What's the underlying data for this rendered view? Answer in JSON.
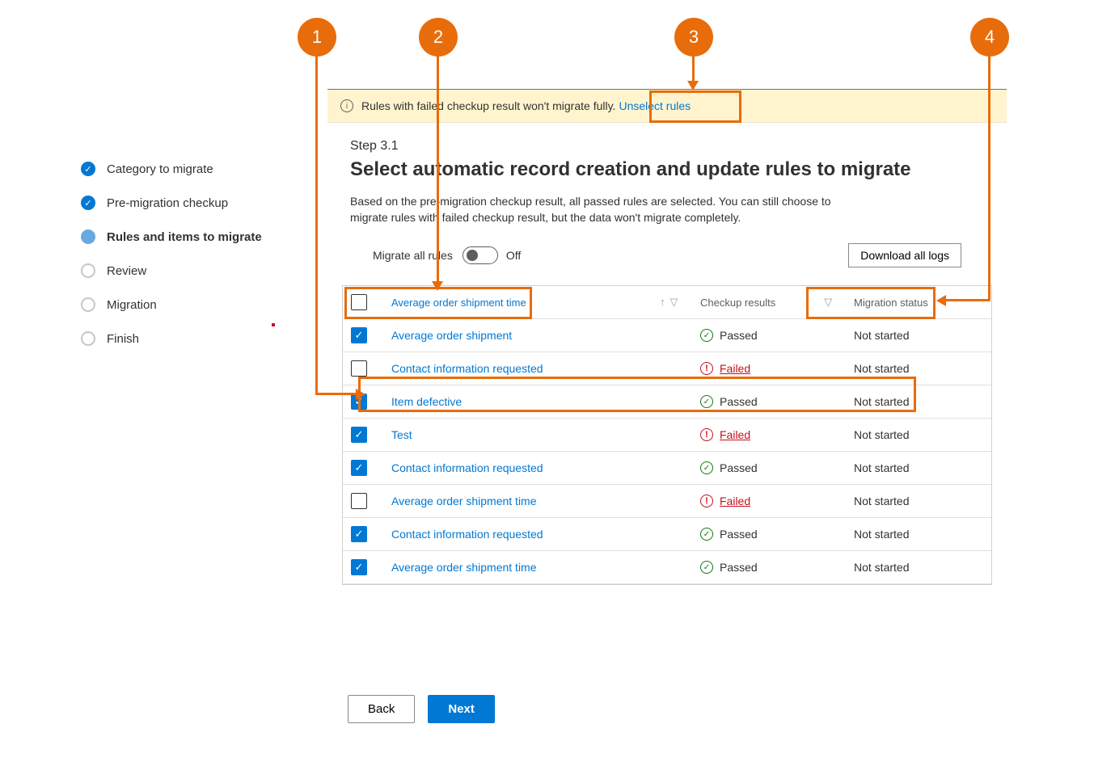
{
  "sidebar": {
    "steps": [
      {
        "label": "Category to migrate",
        "state": "done"
      },
      {
        "label": "Pre-migration checkup",
        "state": "done"
      },
      {
        "label": "Rules and items to migrate",
        "state": "current"
      },
      {
        "label": "Review",
        "state": "todo"
      },
      {
        "label": "Migration",
        "state": "todo"
      },
      {
        "label": "Finish",
        "state": "todo"
      }
    ]
  },
  "banner": {
    "text": "Rules with failed checkup result won't migrate fully.",
    "link": "Unselect rules"
  },
  "header": {
    "step_number": "Step 3.1",
    "title": "Select automatic record creation and update rules to migrate",
    "description": "Based on the pre-migration checkup result, all passed rules are selected. You can still choose to migrate rules with failed checkup result, but the data won't migrate completely."
  },
  "toolbar": {
    "toggle_label": "Migrate all rules",
    "toggle_state": "Off",
    "download_label": "Download all logs"
  },
  "table": {
    "header_name": "Average order shipment time",
    "header_results": "Checkup results",
    "header_status": "Migration status",
    "rows": [
      {
        "checked": true,
        "name": "Average order shipment",
        "result": "Passed",
        "status": "Not started"
      },
      {
        "checked": false,
        "name": "Contact information requested",
        "result": "Failed",
        "status": "Not started"
      },
      {
        "checked": true,
        "name": "Item defective",
        "result": "Passed",
        "status": "Not started"
      },
      {
        "checked": true,
        "name": "Test",
        "result": "Failed",
        "status": "Not started"
      },
      {
        "checked": true,
        "name": "Contact information requested",
        "result": "Passed",
        "status": "Not started"
      },
      {
        "checked": false,
        "name": "Average order shipment time",
        "result": "Failed",
        "status": "Not started"
      },
      {
        "checked": true,
        "name": "Contact information requested",
        "result": "Passed",
        "status": "Not started"
      },
      {
        "checked": true,
        "name": "Average order shipment time",
        "result": "Passed",
        "status": "Not started"
      }
    ]
  },
  "footer": {
    "back": "Back",
    "next": "Next"
  },
  "callouts": {
    "1": "1",
    "2": "2",
    "3": "3",
    "4": "4"
  }
}
